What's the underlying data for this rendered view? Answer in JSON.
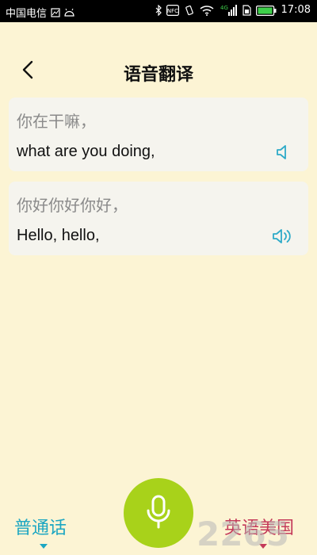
{
  "status_bar": {
    "carrier": "中国电信",
    "time": "17:08",
    "network_label": "4G",
    "nfc_label": "NFC",
    "icons": [
      "image-icon",
      "android-icon",
      "bluetooth-icon",
      "nfc-icon",
      "vibrate-icon",
      "wifi-icon",
      "signal-icon",
      "sim-icon",
      "battery-icon"
    ]
  },
  "header": {
    "title": "语音翻译",
    "back_icon": "chevron-left-icon"
  },
  "translations": [
    {
      "source": "你在干嘛，",
      "target": "what are you doing,",
      "speaker_icon": "speaker-icon"
    },
    {
      "source": "你好你好你好，",
      "target": "Hello, hello,",
      "speaker_icon": "speaker-playing-icon"
    }
  ],
  "bottom_bar": {
    "source_language": "普通话",
    "target_language": "英语美国",
    "mic_icon": "microphone-icon"
  },
  "colors": {
    "background": "#fcf4d4",
    "card": "#f5f4ee",
    "accent_blue": "#1ca6c2",
    "accent_red": "#c43a5a",
    "mic_green": "#a8d21a"
  }
}
